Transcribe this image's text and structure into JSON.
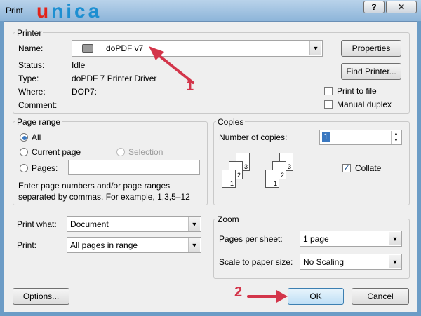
{
  "window": {
    "title": "Print",
    "brand_first": "u",
    "brand_rest": "nica"
  },
  "printer": {
    "group": "Printer",
    "name_label": "Name:",
    "name_value": "doPDF v7",
    "status_label": "Status:",
    "status_value": "Idle",
    "type_label": "Type:",
    "type_value": "doPDF 7 Printer Driver",
    "where_label": "Where:",
    "where_value": "DOP7:",
    "comment_label": "Comment:",
    "properties_button": "Properties",
    "find_printer_button": "Find Printer...",
    "print_to_file": "Print to file",
    "manual_duplex": "Manual duplex"
  },
  "page_range": {
    "group": "Page range",
    "all": "All",
    "current_page": "Current page",
    "selection": "Selection",
    "pages": "Pages:",
    "help": "Enter page numbers and/or page ranges separated by commas.  For example, 1,3,5–12"
  },
  "copies": {
    "group": "Copies",
    "number_label": "Number of copies:",
    "number_value": "1",
    "collate": "Collate",
    "page_numbers": [
      "1",
      "2",
      "3"
    ]
  },
  "print_what": {
    "label": "Print what:",
    "value": "Document"
  },
  "print_option": {
    "label": "Print:",
    "value": "All pages in range"
  },
  "zoom": {
    "group": "Zoom",
    "pages_per_sheet_label": "Pages per sheet:",
    "pages_per_sheet_value": "1 page",
    "scale_label": "Scale to paper size:",
    "scale_value": "No Scaling"
  },
  "buttons": {
    "options": "Options...",
    "ok": "OK",
    "cancel": "Cancel"
  },
  "annotations": {
    "one": "1",
    "two": "2",
    "color": "#d3354a"
  }
}
